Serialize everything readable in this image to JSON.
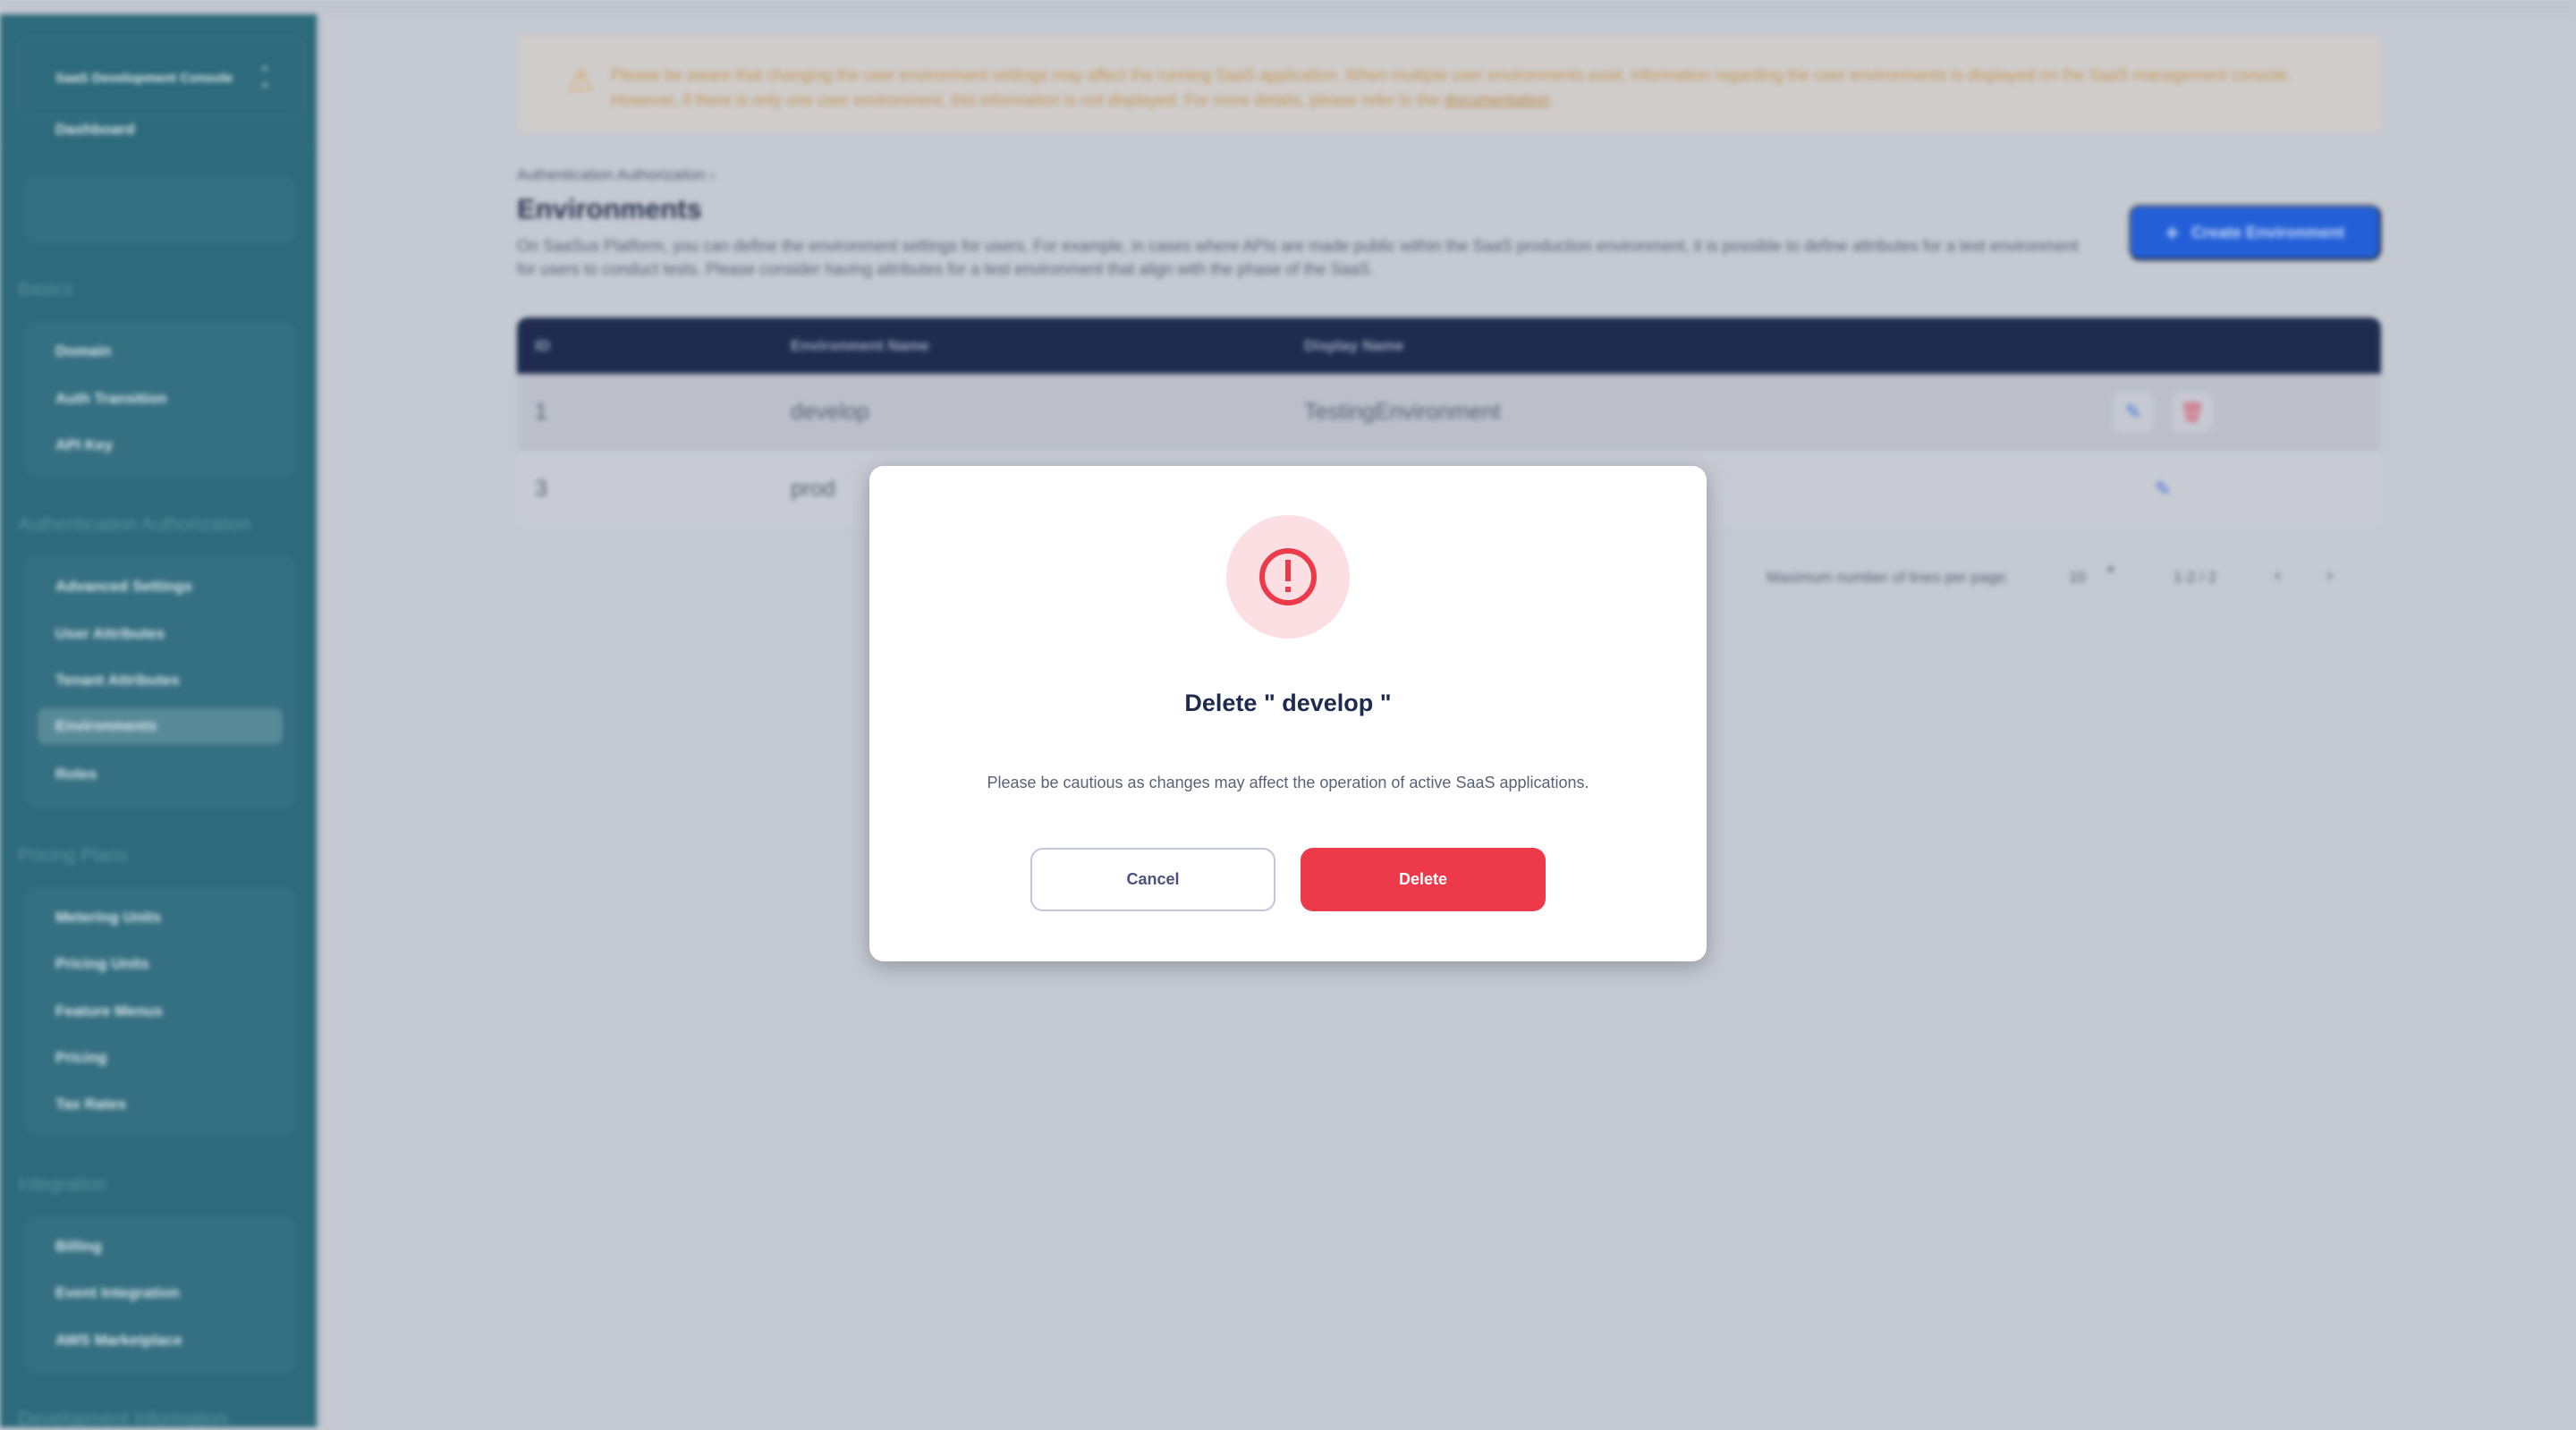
{
  "sidebar": {
    "console": "SaaS Development Console",
    "dashboard": "Dashboard",
    "sections": [
      {
        "title": "Basics",
        "items": [
          "Domain",
          "Auth Transition",
          "API Key"
        ]
      },
      {
        "title": "Authentication Authorization",
        "items": [
          "Advanced Settings",
          "User Attributes",
          "Tenant Attributes",
          "Environments",
          "Roles"
        ],
        "selected": "Environments"
      },
      {
        "title": "Pricing Plans",
        "items": [
          "Metering Units",
          "Pricing Units",
          "Feature Menus",
          "Pricing",
          "Tax Rates"
        ]
      },
      {
        "title": "Integration",
        "items": [
          "Billing",
          "Event Integration",
          "AWS Marketplace"
        ]
      },
      {
        "title": "Development Information",
        "items": []
      }
    ]
  },
  "warning": {
    "icon": "warning-triangle-icon",
    "text": "Please be aware that changing the user environment settings may affect the running SaaS application. When multiple user environments exist, information regarding the user environments is displayed on the SaaS management console. However, if there is only one user environment, this information is not displayed. For more details, please refer to the ",
    "link": "documentation",
    "end": "."
  },
  "page": {
    "breadcrumb": "Authentication Authorization",
    "title": "Environments",
    "description": "On SaaSus Platform, you can define the environment settings for users. For example, in cases where APIs are made public within the SaaS production environment, it is possible to define attributes for a test environment for users to conduct tests. Please consider having attributes for a test environment that align with the phase of the SaaS.",
    "create_button": "Create Environment"
  },
  "table": {
    "columns": [
      "ID",
      "Environment Name",
      "Display Name"
    ],
    "rows": [
      {
        "id": "1",
        "name": "develop",
        "display": "TestingEnvironment"
      },
      {
        "id": "3",
        "name": "prod",
        "display": ""
      }
    ]
  },
  "pagination": {
    "label": "Maximum number of lines per page:",
    "per_page": "10",
    "range": "1-2 / 2"
  },
  "modal": {
    "icon": "exclamation-circle-icon",
    "title": "Delete \" develop \"",
    "message": "Please be cautious as changes may affect the operation of active SaaS applications.",
    "cancel": "Cancel",
    "delete": "Delete"
  },
  "colors": {
    "danger": "#ED3A4B",
    "primary": "#2360D8",
    "sidebar": "#2D6A7C",
    "table_header": "#1F2C4F"
  }
}
